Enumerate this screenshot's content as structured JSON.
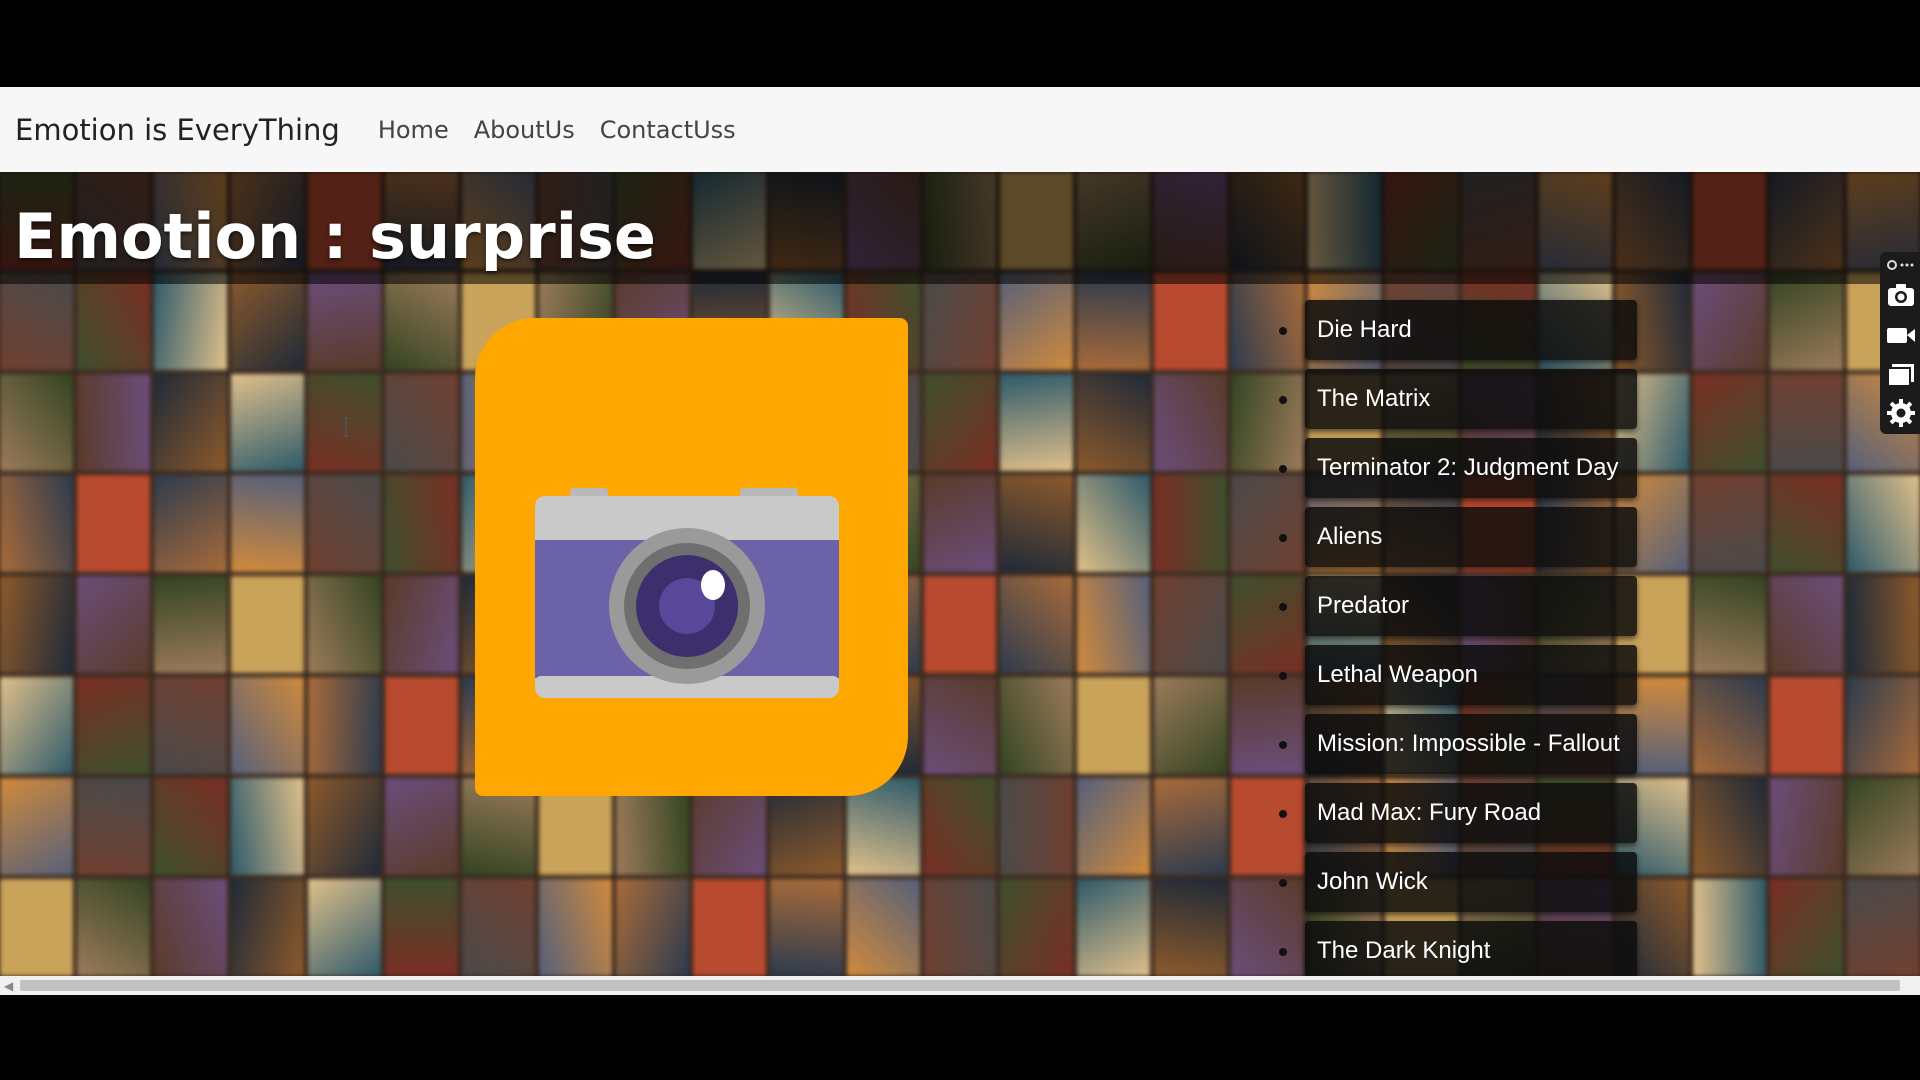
{
  "navbar": {
    "brand": "Emotion is EveryThing",
    "links": [
      {
        "label": "Home"
      },
      {
        "label": "AboutUs"
      },
      {
        "label": "ContactUss"
      }
    ]
  },
  "main": {
    "emotion_title": "Emotion : surprise",
    "camera_icon": "camera-icon",
    "movies": [
      "Die Hard",
      "The Matrix",
      "Terminator 2: Judgment Day",
      "Aliens",
      "Predator",
      "Lethal Weapon",
      "Mission: Impossible - Fallout",
      "Mad Max: Fury Road",
      "John Wick",
      "The Dark Knight"
    ]
  },
  "toolbar": {
    "icons": [
      "link-icon",
      "camera-icon",
      "video-icon",
      "window-icon",
      "gear-icon"
    ]
  },
  "colors": {
    "camera_tile": "#fea700",
    "camera_body": "#6c62a8",
    "camera_top": "#c9c9c9",
    "navbar_bg": "#f7f7f7"
  }
}
